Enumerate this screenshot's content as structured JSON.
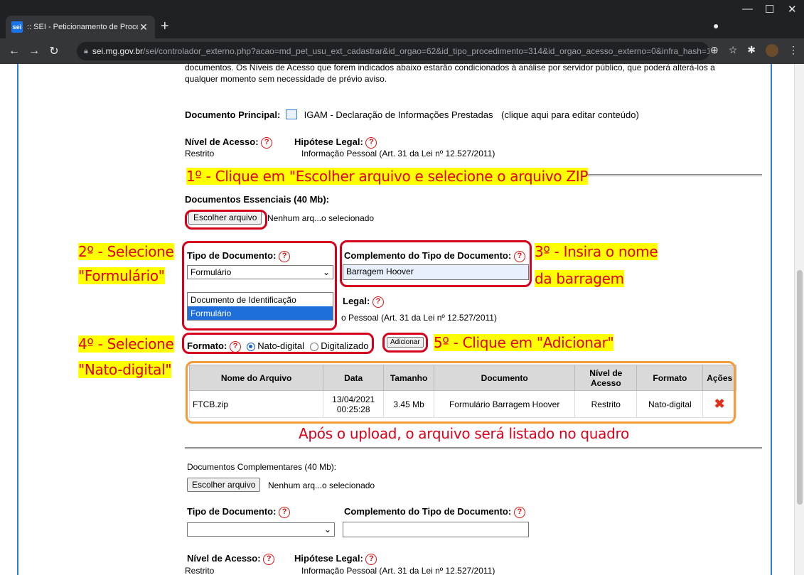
{
  "browser": {
    "tab_favicon": "sei",
    "tab_title": ":: SEI - Peticionamento de Proces",
    "url_host": "sei.mg.gov.br",
    "url_rest": "/sei/controlador_externo.php?acao=md_pet_usu_ext_cadastrar&id_orgao=62&id_tipo_procedimento=314&id_orgao_acesso_externo=0&infra_hash=1..."
  },
  "intro": {
    "line1": "documentos. Os Níveis de Acesso que forem indicados abaixo estarão condicionados à análise por servidor público, que poderá alterá-los a",
    "line2": "qualquer momento sem necessidade de prévio aviso."
  },
  "principal": {
    "label": "Documento Principal:",
    "doc_name": "IGAM - Declaração de Informações Prestadas",
    "edit_hint": "(clique aqui para editar conteúdo)",
    "nivel_label": "Nível de Acesso:",
    "nivel_value": "Restrito",
    "hipotese_label": "Hipótese Legal:",
    "hipotese_value": "Informação Pessoal (Art. 31 da Lei nº 12.527/2011)"
  },
  "essenciais": {
    "label": "Documentos Essenciais (40 Mb):",
    "choose_button": "Escolher arquivo",
    "no_file": "Nenhum arq...o selecionado",
    "tipo_label": "Tipo de Documento:",
    "tipo_selected": "Formulário",
    "tipo_options": [
      "Documento de Identificação",
      "Formulário"
    ],
    "complemento_label": "Complemento do Tipo de Documento:",
    "complemento_value": "Barragem Hoover",
    "legal_partial": "Legal:",
    "hipotese_partial": "o Pessoal (Art. 31 da Lei nº 12.527/2011)",
    "formato_label": "Formato:",
    "radio_nato": "Nato-digital",
    "radio_digit": "Digitalizado",
    "add_button": "Adicionar"
  },
  "table": {
    "headers": [
      "Nome do Arquivo",
      "Data",
      "Tamanho",
      "Documento",
      "Nível de Acesso",
      "Formato",
      "Ações"
    ],
    "rows": [
      {
        "nome": "FTCB.zip",
        "data": "13/04/2021 00:25:28",
        "tamanho": "3.45 Mb",
        "documento": "Formulário Barragem Hoover",
        "nivel": "Restrito",
        "formato": "Nato-digital"
      }
    ]
  },
  "complementares": {
    "label": "Documentos Complementares (40 Mb):",
    "choose_button": "Escolher arquivo",
    "no_file": "Nenhum arq...o selecionado",
    "tipo_label": "Tipo de Documento:",
    "complemento_label": "Complemento do Tipo de Documento:",
    "nivel_label": "Nível de Acesso:",
    "hipotese_label": "Hipótese Legal:",
    "nivel_value": "Restrito",
    "hipotese_value": "Informação Pessoal (Art. 31 da Lei nº 12.527/2011)"
  },
  "annotations": {
    "step1": "1º - Clique em \"Escolher arquivo e selecione o arquivo ZIP",
    "step2_line1": "2º - Selecione",
    "step2_line2": "\"Formulário\"",
    "step3_line1": "3º - Insira o nome",
    "step3_line2": "da barragem",
    "step4_line1": "4º - Selecione",
    "step4_line2": "\"Nato-digital\"",
    "step5": "5º - Clique em \"Adicionar\"",
    "after_upload": "Após o upload, o arquivo será listado no quadro"
  },
  "colors": {
    "annotation_text": "#e0001b",
    "annotation_bg": "#ffff00",
    "ring_red": "#d7001a",
    "ring_orange": "#f39c3a",
    "page_border": "#2b7fd9"
  }
}
